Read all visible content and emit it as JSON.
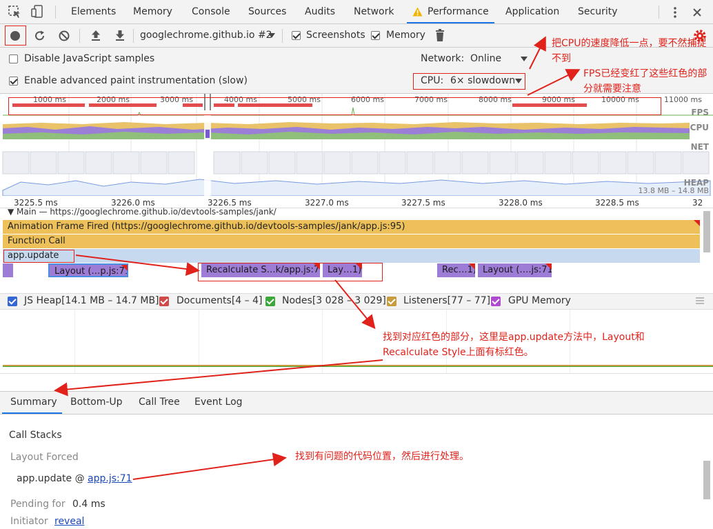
{
  "tabs": {
    "items": [
      "Elements",
      "Memory",
      "Console",
      "Sources",
      "Audits",
      "Network",
      "Performance",
      "Application",
      "Security"
    ],
    "active": "Performance"
  },
  "toolbar": {
    "profile_select": "googlechrome.github.io #2",
    "screenshots_label": "Screenshots",
    "memory_label": "Memory"
  },
  "settings": {
    "disable_js_label": "Disable JavaScript samples",
    "advanced_paint_label": "Enable advanced paint instrumentation (slow)",
    "network_label": "Network:",
    "network_value": "Online",
    "cpu_label": "CPU:",
    "cpu_value": "6× slowdown"
  },
  "overview": {
    "ticks": [
      "1000 ms",
      "2000 ms",
      "3000 ms",
      "4000 ms",
      "5000 ms",
      "6000 ms",
      "7000 ms",
      "8000 ms",
      "9000 ms",
      "10000 ms",
      "11000 ms"
    ],
    "lanes": {
      "fps": "FPS",
      "cpu": "CPU",
      "net": "NET",
      "heap": "HEAP"
    },
    "heap_range": "13.8 MB – 14.8 MB"
  },
  "timeline": {
    "ruler": [
      "3225.5 ms",
      "3226.0 ms",
      "3226.5 ms",
      "3227.0 ms",
      "3227.5 ms",
      "3228.0 ms",
      "3228.5 ms",
      "32"
    ],
    "main_label": "▼ Main — https://googlechrome.github.io/devtools-samples/jank/",
    "animation_frame": "Animation Frame Fired (https://googlechrome.github.io/devtools-samples/jank/app.js:95)",
    "function_call": "Function Call",
    "app_update": "app.update",
    "layout1": "Layout (…p.js:71)",
    "recalc": "Recalculate S…k/app.js:71)",
    "lay2": "Lay…1)",
    "rec2": "Rec…1)",
    "layout3": "Layout (….js:71)"
  },
  "counters": {
    "js_heap": "JS Heap[14.1 MB – 14.7 MB]",
    "documents": "Documents[4 – 4]",
    "nodes": "Nodes[3 028 – 3 029]",
    "listeners": "Listeners[77 – 77]",
    "gpu": "GPU Memory",
    "colors": {
      "js_heap": "#3367d6",
      "documents": "#d14a4a",
      "nodes": "#3ca83c",
      "listeners": "#c89b3c",
      "gpu": "#b04ad1"
    }
  },
  "bottom_tabs": [
    "Summary",
    "Bottom-Up",
    "Call Tree",
    "Event Log"
  ],
  "summary": {
    "call_stacks": "Call Stacks",
    "layout_forced": "Layout Forced",
    "stack_fn": "app.update @ ",
    "stack_link": "app.js:71",
    "pending_label": "Pending for",
    "pending_value": "0.4 ms",
    "initiator_label": "Initiator",
    "initiator_link": "reveal"
  },
  "annotations": {
    "cpu_note": "把CPU的速度降低一点，要不然捕捉不到",
    "fps_note": "FPS已经变红了这些红色的部分就需要注意",
    "app_update_note": "找到对应红色的部分，这里是app.update方法中，Layout和Recalculate Style上面有标红色。",
    "code_note": "找到有问题的代码位置，然后进行处理。"
  }
}
